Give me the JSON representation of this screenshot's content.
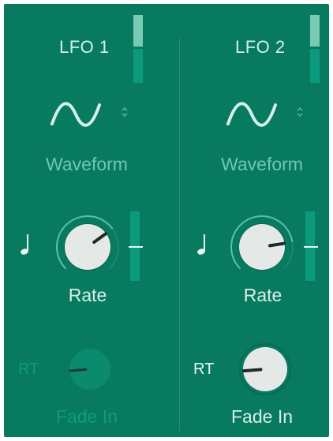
{
  "lfo1": {
    "title": "LFO 1",
    "waveform_label": "Waveform",
    "rate_label": "Rate",
    "rt_label": "RT",
    "fade_label": "Fade In",
    "rate_value": 0.7,
    "fade_value": 0.15,
    "level_fraction": 0.5,
    "rate_meter_fraction": 0.55
  },
  "lfo2": {
    "title": "LFO 2",
    "waveform_label": "Waveform",
    "rate_label": "Rate",
    "rt_label": "RT",
    "fade_label": "Fade In",
    "rate_value": 0.8,
    "fade_value": 0.15,
    "level_fraction": 0.5,
    "rate_meter_fraction": 0.55
  },
  "colors": {
    "panel": "#087a60",
    "label": "#6ec7ad",
    "label_bright": "#d6efe6",
    "knob_face": "#e4e9e7",
    "knob_dark": "#0b8a6d"
  },
  "icons": {
    "waveform": "sine-wave-icon",
    "stepper": "up-down-chevron-icon",
    "sync": "quarter-note-icon"
  }
}
